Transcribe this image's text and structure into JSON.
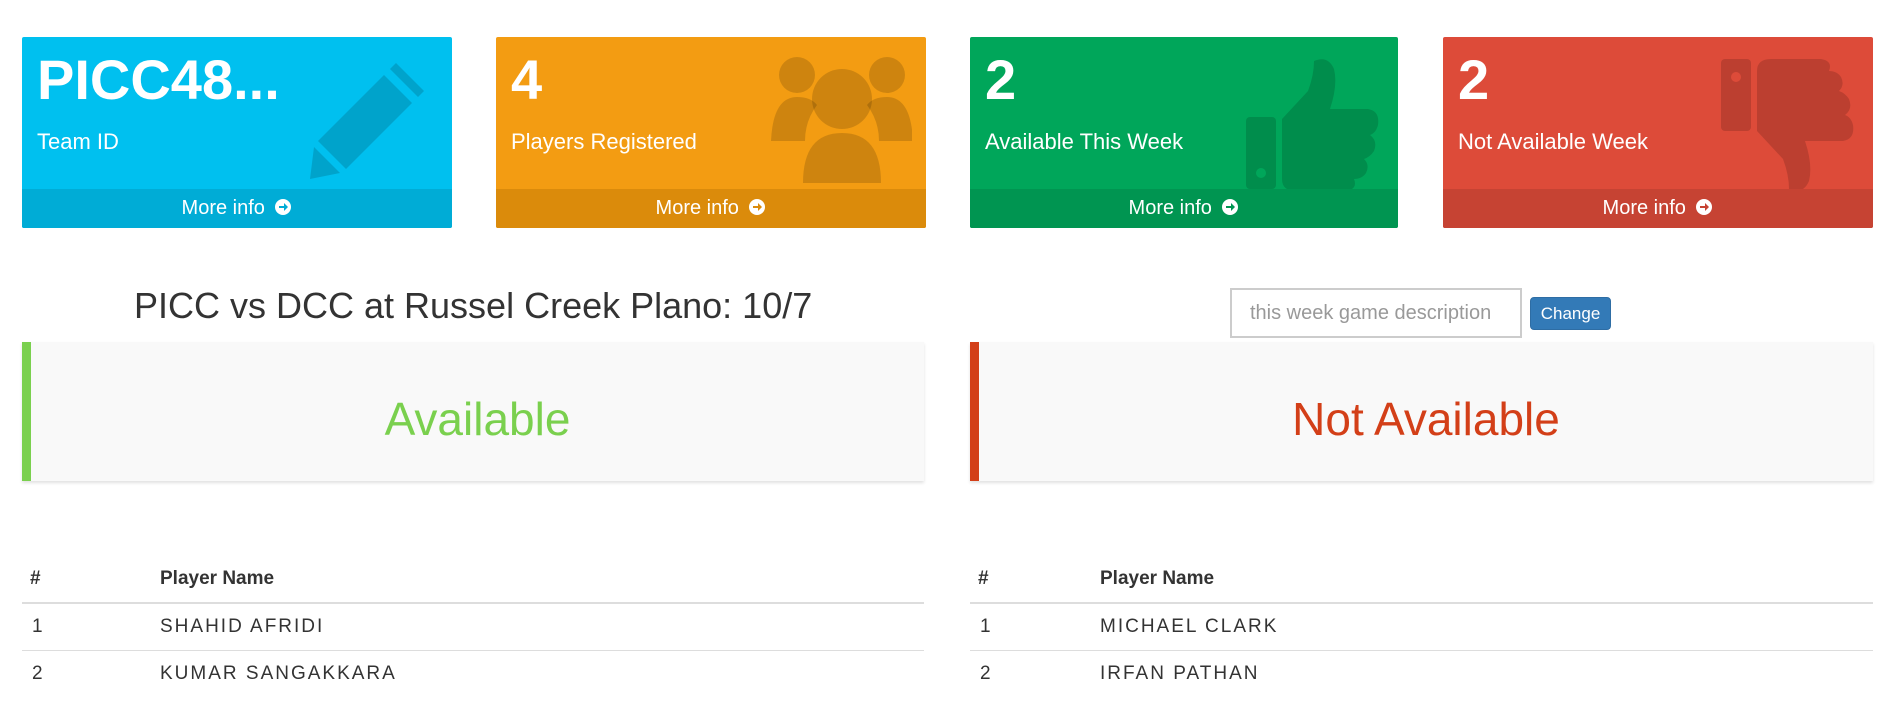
{
  "boxes": [
    {
      "value": "PICC48...",
      "label": "Team ID",
      "footer": "More info",
      "icon": "pencil-icon",
      "color": "#00c0ef",
      "footer_color": "#00acd6"
    },
    {
      "value": "4",
      "label": "Players Registered",
      "footer": "More info",
      "icon": "users-icon",
      "color": "#f39c12",
      "footer_color": "#db8b0b"
    },
    {
      "value": "2",
      "label": "Available This Week",
      "footer": "More info",
      "icon": "thumbs-up-icon",
      "color": "#00a65a",
      "footer_color": "#009551"
    },
    {
      "value": "2",
      "label": "Not Available Week",
      "footer": "More info",
      "icon": "thumbs-down-icon",
      "color": "#dd4b39",
      "footer_color": "#c64333"
    }
  ],
  "game": {
    "title": "PICC vs DCC at Russel Creek Plano: 10/7",
    "description_placeholder": "this week game description",
    "change_label": "Change"
  },
  "available": {
    "heading": "Available",
    "color": "#7ad04e",
    "columns": [
      "#",
      "Player Name"
    ],
    "rows": [
      {
        "num": "1",
        "name": "SHAHID AFRIDI"
      },
      {
        "num": "2",
        "name": "KUMAR SANGAKKARA"
      }
    ]
  },
  "not_available": {
    "heading": "Not Available",
    "color": "#d33f18",
    "columns": [
      "#",
      "Player Name"
    ],
    "rows": [
      {
        "num": "1",
        "name": "MICHAEL CLARK"
      },
      {
        "num": "2",
        "name": "IRFAN PATHAN"
      }
    ]
  }
}
